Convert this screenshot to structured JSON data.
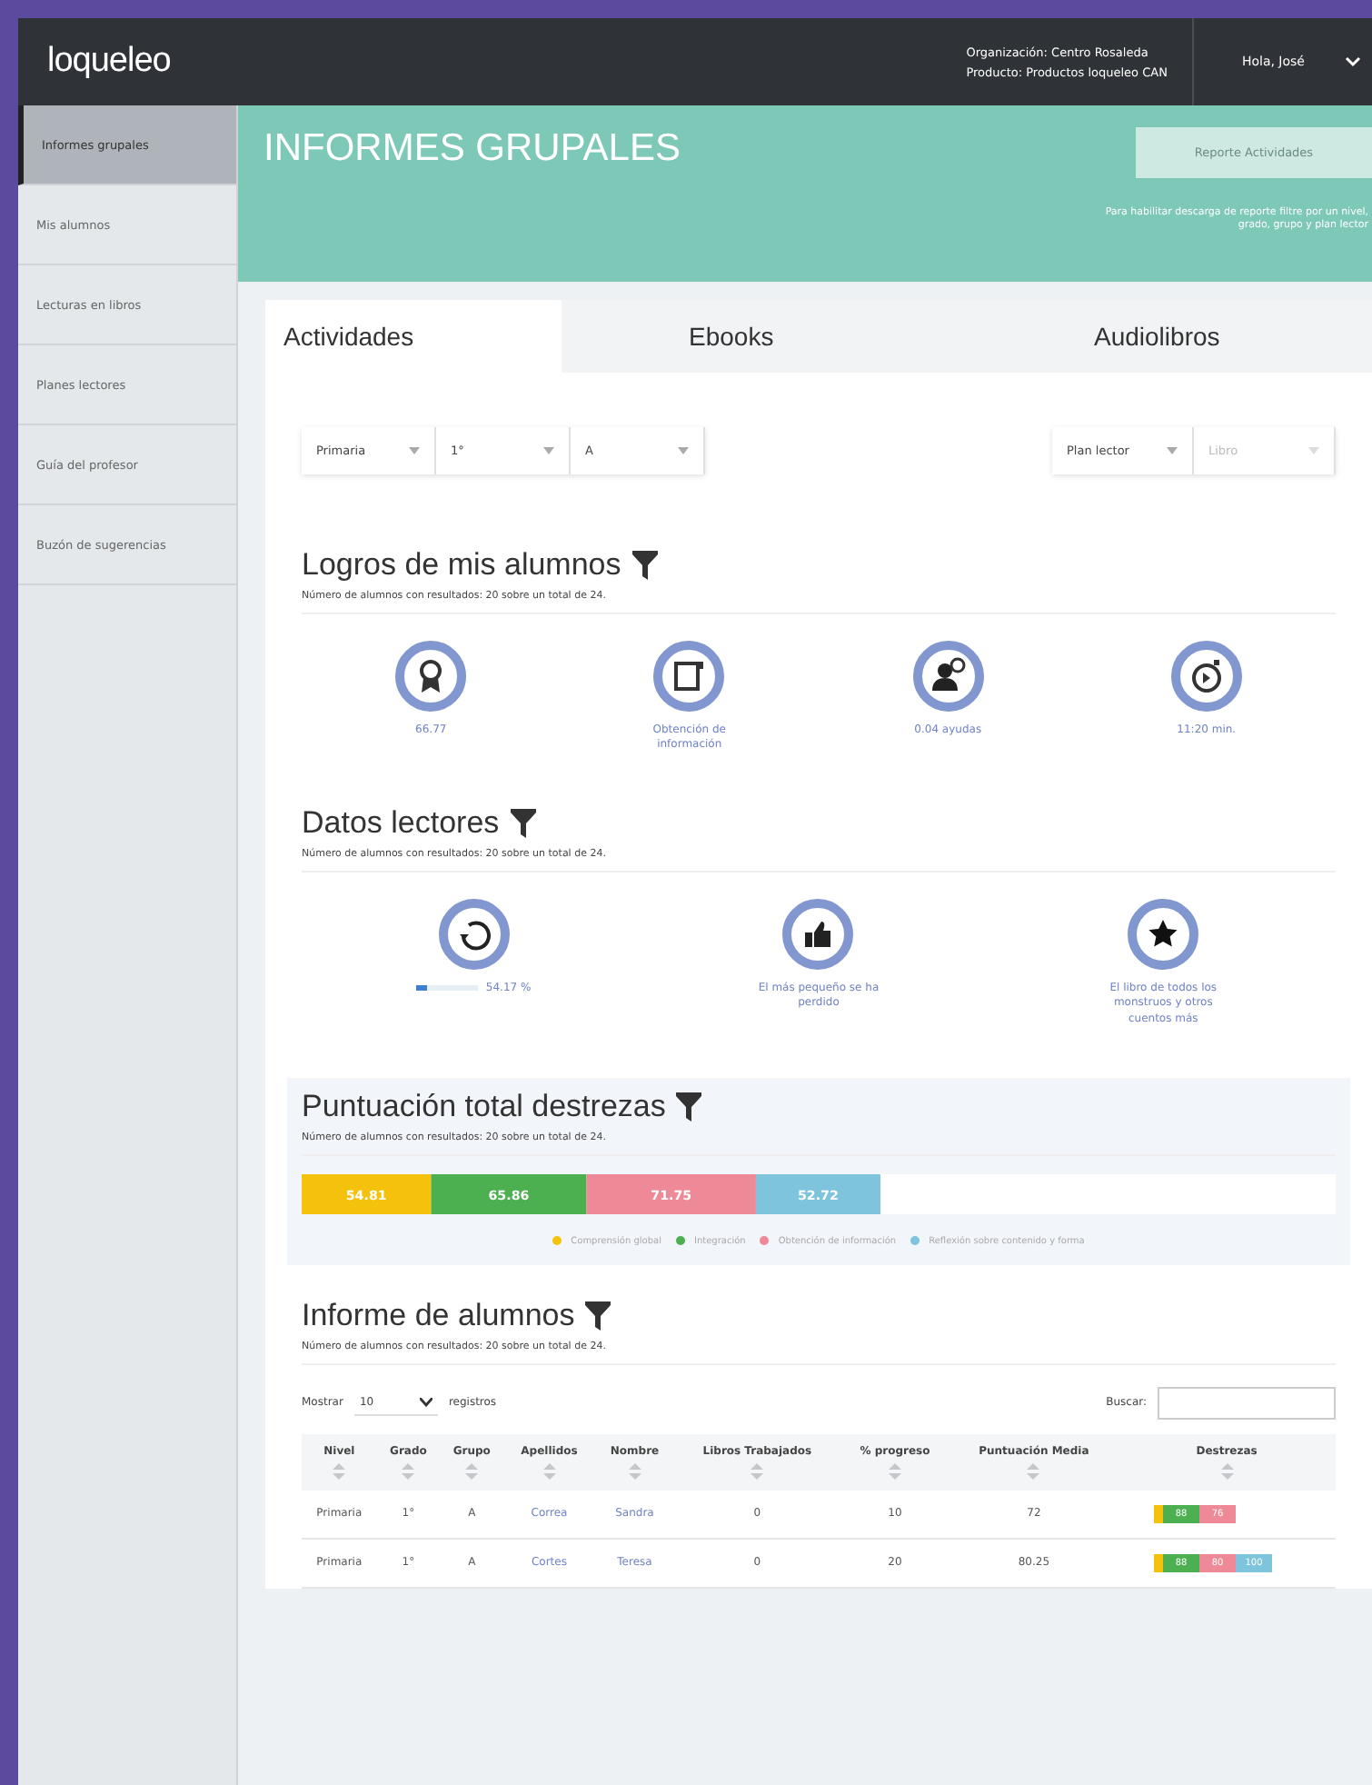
{
  "header": {
    "logo": "loqueleo",
    "organization": "Organización: Centro Rosaleda",
    "product": "Producto: Productos loqueleo CAN",
    "greeting": "Hola, José"
  },
  "sidebar": {
    "items": [
      {
        "label": "Informes grupales",
        "selected": true
      },
      {
        "label": "Mis alumnos",
        "selected": false
      },
      {
        "label": "Lecturas en libros",
        "selected": false
      },
      {
        "label": "Planes lectores",
        "selected": false
      },
      {
        "label": "Guía del profesor",
        "selected": false
      },
      {
        "label": "Buzón de sugerencias",
        "selected": false
      }
    ]
  },
  "banner": {
    "title": "INFORMES GRUPALES",
    "button": "Reporte Actividades",
    "note": "Para habilitar descarga de reporte filtre por un nivel, grado, grupo y plan lector"
  },
  "tabs": [
    {
      "label": "Actividades",
      "selected": true
    },
    {
      "label": "Ebooks",
      "selected": false
    },
    {
      "label": "Audiolibros",
      "selected": false
    }
  ],
  "filters": {
    "left": [
      {
        "value": "Primaria",
        "disabled": false
      },
      {
        "value": "1°",
        "disabled": false
      },
      {
        "value": "A",
        "disabled": false
      }
    ],
    "right": [
      {
        "value": "Plan lector",
        "disabled": false
      },
      {
        "value": "Libro",
        "disabled": true
      }
    ]
  },
  "achievements": {
    "title": "Logros de mis alumnos",
    "subtitle": "Número de alumnos con resultados: 20 sobre un total de 24.",
    "stats": [
      {
        "kind": "medal",
        "text": "66.77"
      },
      {
        "kind": "document",
        "text": "Obtención de información"
      },
      {
        "kind": "help",
        "text": "0.04 ayudas"
      },
      {
        "kind": "timer",
        "text": "11:20 min."
      }
    ]
  },
  "reading": {
    "title": "Datos lectores",
    "subtitle": "Número de alumnos con resultados: 20 sobre un total de 24.",
    "stats": [
      {
        "kind": "progress",
        "text": "54.17 %",
        "level": 0.15
      },
      {
        "kind": "thumb",
        "text": "El más pequeño se ha perdido"
      },
      {
        "kind": "star",
        "text": "El libro de todos los monstruos y otros cuentos más"
      }
    ]
  },
  "skills": {
    "title": "Puntuación total destrezas",
    "subtitle": "Número de alumnos con resultados: 20 sobre un total de 24.",
    "chart_data": {
      "type": "bar",
      "orientation": "horizontal",
      "stacked": true,
      "data_labels": true,
      "categories": [
        null
      ],
      "xlim": [
        0,
        438
      ],
      "legend": "bottom",
      "series": [
        {
          "name": "Comprensión global",
          "color": "#f4c20d",
          "values": [
            54.81
          ]
        },
        {
          "name": "Integración",
          "color": "#4caf50",
          "values": [
            65.86
          ]
        },
        {
          "name": "Obtención de información",
          "color": "#ee8a97",
          "values": [
            71.75
          ]
        },
        {
          "name": "Reflexión sobre contenido y forma",
          "color": "#7ec4dc",
          "values": [
            52.72
          ]
        }
      ]
    }
  },
  "report": {
    "title": "Informe de alumnos",
    "subtitle": "Número de alumnos con resultados: 20 sobre un total de 24.",
    "show_label": "Mostrar",
    "page_size": "10",
    "records_label": "registros",
    "search_label": "Buscar:",
    "columns": [
      "Nivel",
      "Grado",
      "Grupo",
      "Apellidos",
      "Nombre",
      "Libros Trabajados",
      "% progreso",
      "Puntuación Media",
      "Destrezas"
    ],
    "rows": [
      {
        "cells": [
          "Primaria",
          "1°",
          "A",
          "Correa",
          "Sandra",
          "0",
          "10",
          "72"
        ],
        "skills": [
          {
            "color": "#f4c20d"
          },
          {
            "value": "88",
            "color": "#4caf50"
          },
          {
            "value": "76",
            "color": "#ee8a97"
          }
        ]
      },
      {
        "cells": [
          "Primaria",
          "1°",
          "A",
          "Cortes",
          "Teresa",
          "0",
          "20",
          "80.25"
        ],
        "skills": [
          {
            "color": "#f4c20d"
          },
          {
            "value": "88",
            "color": "#4caf50"
          },
          {
            "value": "80",
            "color": "#ee8a97"
          },
          {
            "value": "100",
            "color": "#7ec4dc"
          }
        ]
      }
    ]
  }
}
